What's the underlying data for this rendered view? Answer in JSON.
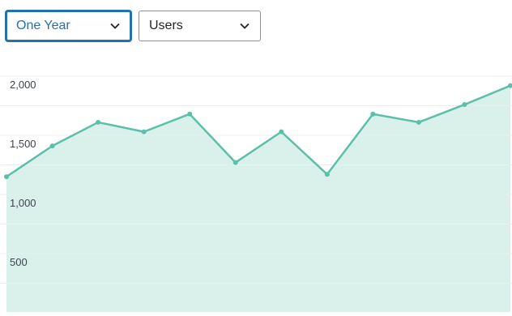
{
  "filters": {
    "range": {
      "selected": "One Year",
      "icon": "chevron-down-icon"
    },
    "metric": {
      "selected": "Users",
      "icon": "chevron-down-icon"
    }
  },
  "colors": {
    "line": "#5bbfa9",
    "area": "#d3ede7",
    "grid": "#e4e4e4",
    "accent": "#2271b1"
  },
  "chart_data": {
    "type": "area",
    "title": "",
    "xlabel": "",
    "ylabel": "",
    "ylim": [
      0,
      2000
    ],
    "yticks": [
      {
        "value": 2000,
        "label": "2,000"
      },
      {
        "value": 1500,
        "label": "1,500"
      },
      {
        "value": 1000,
        "label": "1,000"
      },
      {
        "value": 500,
        "label": "500"
      }
    ],
    "grid": true,
    "series": [
      {
        "values": [
          1150,
          1410,
          1610,
          1530,
          1680,
          1270,
          1530,
          1170,
          1680,
          1610,
          1760,
          1920
        ]
      }
    ]
  }
}
